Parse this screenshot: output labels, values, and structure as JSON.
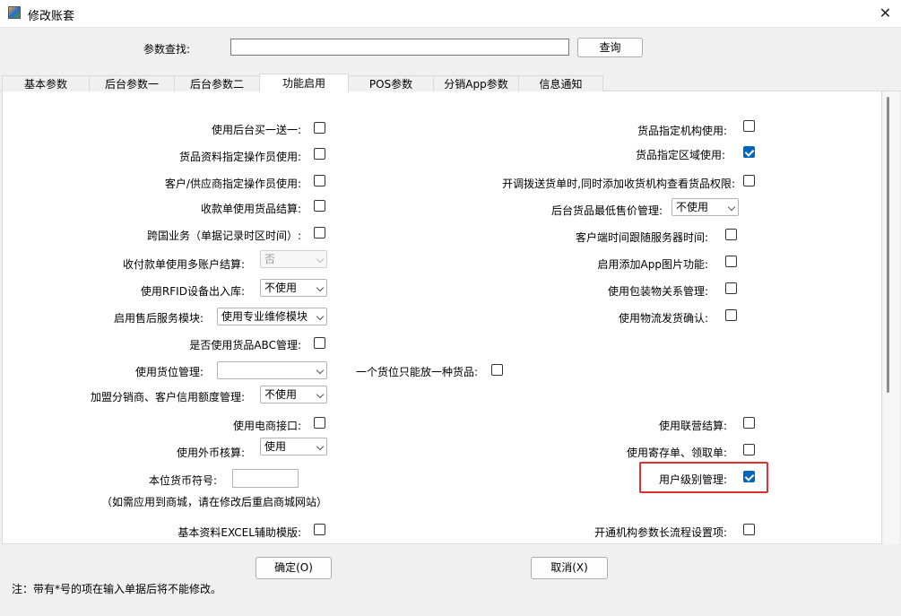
{
  "window": {
    "title": "修改账套",
    "close_glyph": "✕"
  },
  "search": {
    "label": "参数查找:",
    "value": "",
    "button": "查询"
  },
  "tabs": [
    {
      "label": "基本参数",
      "active": false
    },
    {
      "label": "后台参数一",
      "active": false
    },
    {
      "label": "后台参数二",
      "active": false
    },
    {
      "label": "功能启用",
      "active": true
    },
    {
      "label": "POS参数",
      "active": false
    },
    {
      "label": "分销App参数",
      "active": false
    },
    {
      "label": "信息通知",
      "active": false
    }
  ],
  "left": {
    "buy_one_get_one": "使用后台买一送一:",
    "goods_operator": "货品资料指定操作员使用:",
    "customer_supplier_operator": "客户/供应商指定操作员使用:",
    "receipt_goods_settle": "收款单使用货品结算:",
    "cross_border": "跨国业务（单据记录时区时间）:",
    "multi_account": "收付款单使用多账户结算:",
    "multi_account_value": "否",
    "rfid": "使用RFID设备出入库:",
    "rfid_value": "不使用",
    "after_sales": "启用售后服务模块:",
    "after_sales_value": "使用专业维修模块",
    "abc_manage": "是否使用货品ABC管理:",
    "location_manage": "使用货位管理:",
    "location_manage_value": "",
    "one_goods_per_location": "一个货位只能放一种货品:",
    "franchise_credit": "加盟分销商、客户信用额度管理:",
    "franchise_credit_value": "不使用",
    "ecommerce_api": "使用电商接口:",
    "foreign_currency": "使用外币核算:",
    "foreign_currency_value": "使用",
    "local_currency_symbol": "本位货币符号:",
    "local_currency_value": "",
    "mall_note": "（如需应用到商城，请在修改后重启商城网站）",
    "excel_template": "基本资料EXCEL辅助模版:"
  },
  "right": {
    "goods_org": "货品指定机构使用:",
    "goods_region": "货品指定区域使用:",
    "transfer_permission": "开调拨送货单时,同时添加收货机构查看货品权限:",
    "min_price": "后台货品最低售价管理:",
    "min_price_value": "不使用",
    "client_time": "客户端时间跟随服务器时间:",
    "app_image": "启用添加App图片功能:",
    "packaging": "使用包装物关系管理:",
    "logistics": "使用物流发货确认:",
    "joint_settle": "使用联营结算:",
    "consignment": "使用寄存单、领取单:",
    "user_level": "用户级别管理:",
    "long_flow": "开通机构参数长流程设置项:"
  },
  "checks": {
    "buy_one_get_one": false,
    "goods_operator": false,
    "customer_supplier_operator": false,
    "receipt_goods_settle": false,
    "cross_border": false,
    "abc_manage": false,
    "one_goods_per_location": false,
    "ecommerce_api": false,
    "excel_template": false,
    "goods_org": false,
    "goods_region": true,
    "transfer_permission": false,
    "client_time": false,
    "app_image": false,
    "packaging": false,
    "logistics": false,
    "joint_settle": false,
    "consignment": false,
    "user_level": true,
    "long_flow": false
  },
  "buttons": {
    "ok": "确定(O)",
    "cancel": "取消(X)"
  },
  "footer_note": "注：带有*号的项在输入单据后将不能修改。",
  "colors": {
    "checked": "#0067c0",
    "highlight": "#e03030"
  }
}
